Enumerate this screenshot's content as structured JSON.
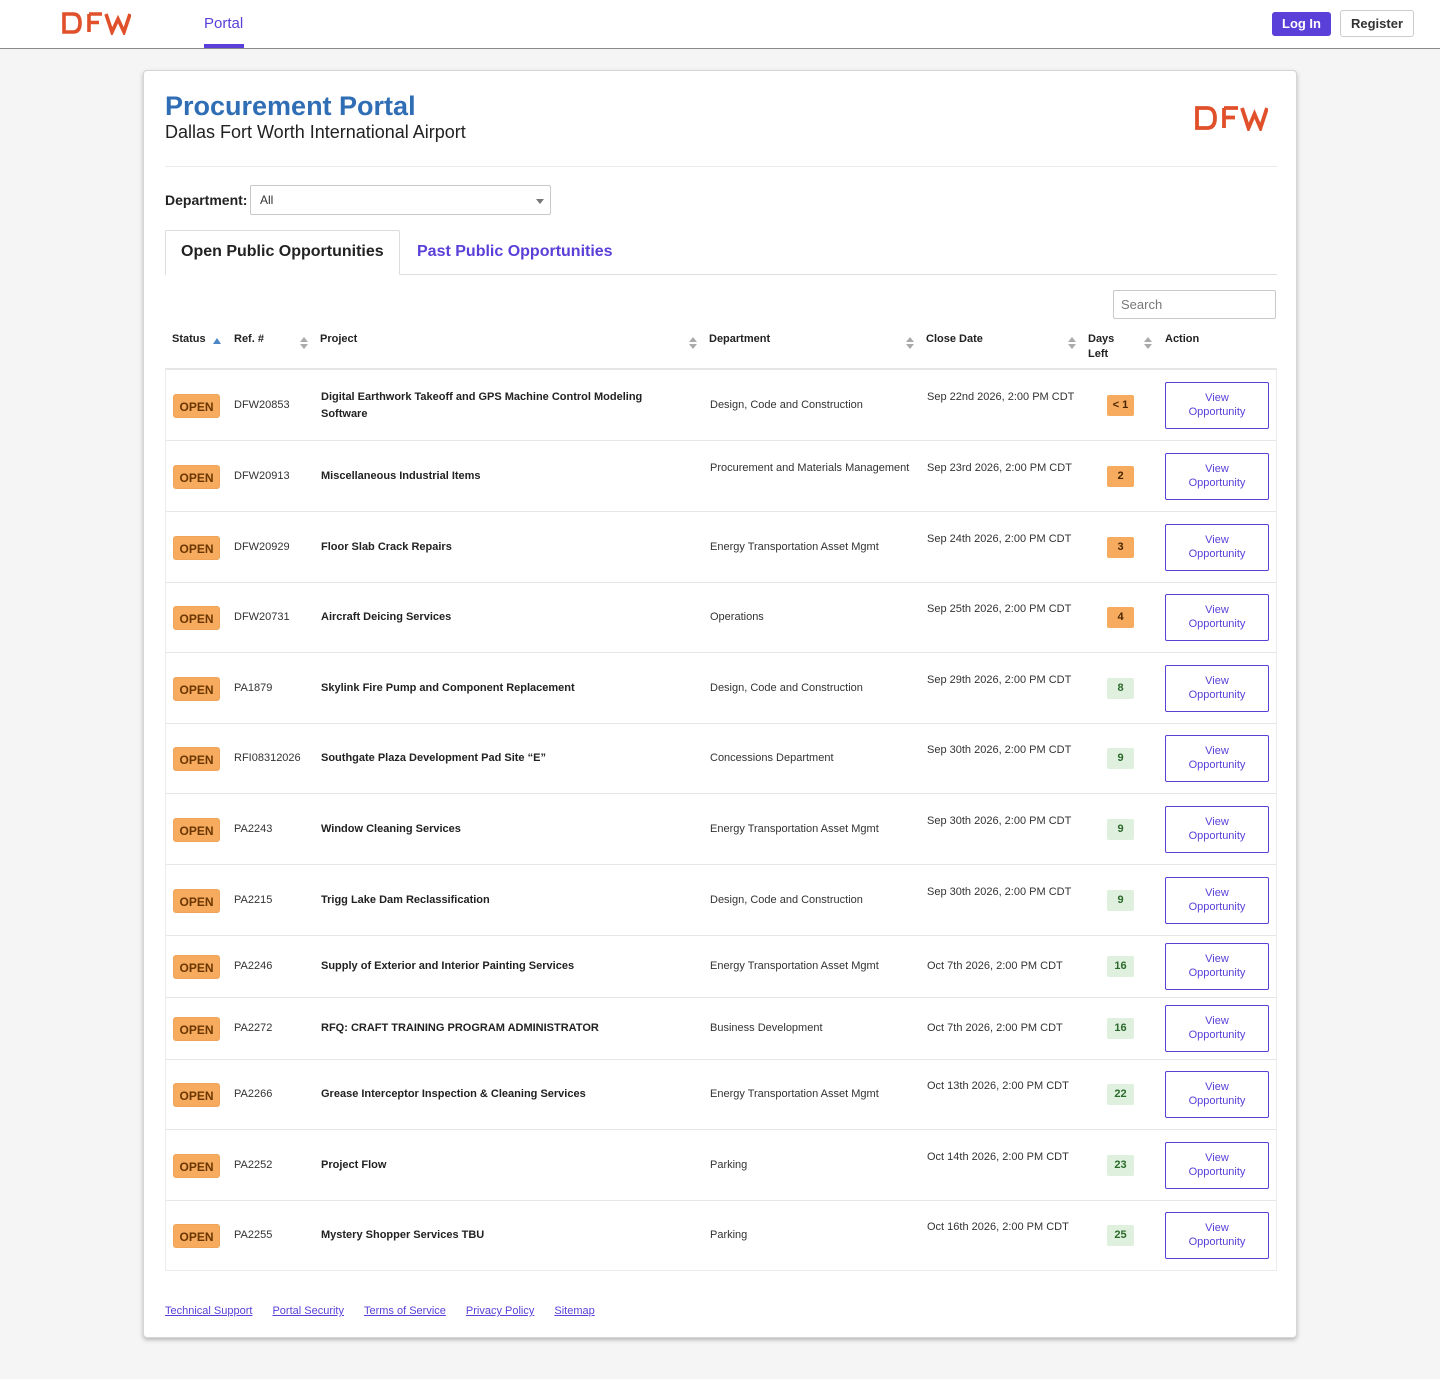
{
  "nav": {
    "logo_text": "DFW",
    "tab_label": "Portal",
    "login_label": "Log In",
    "register_label": "Register"
  },
  "header": {
    "title": "Procurement Portal",
    "subtitle": "Dallas Fort Worth International Airport",
    "logo_text": "DFW"
  },
  "filter": {
    "department_label": "Department:",
    "department_value": "All"
  },
  "tabs": [
    {
      "label": "Open Public Opportunities",
      "active": true
    },
    {
      "label": "Past Public Opportunities",
      "active": false
    }
  ],
  "search": {
    "placeholder": "Search"
  },
  "table": {
    "columns": {
      "status": "Status",
      "ref": "Ref. #",
      "project": "Project",
      "department": "Department",
      "close_date": "Close Date",
      "days_left": "Days Left",
      "action": "Action"
    },
    "rows": [
      {
        "status": "OPEN",
        "ref": "DFW20853",
        "project": "Digital Earthwork Takeoff and GPS Machine Control Modeling Software",
        "department": "Design, Code and Construction",
        "close_date": "Sep 22nd 2026, 2:00 PM CDT",
        "days_left": "< 1",
        "days_color": "orange",
        "action": "View Opportunity"
      },
      {
        "status": "OPEN",
        "ref": "DFW20913",
        "project": "Miscellaneous Industrial Items",
        "department": "Procurement and Materials Management",
        "close_date": "Sep 23rd 2026, 2:00 PM CDT",
        "days_left": "2",
        "days_color": "orange",
        "action": "View Opportunity"
      },
      {
        "status": "OPEN",
        "ref": "DFW20929",
        "project": "Floor Slab Crack Repairs",
        "department": "Energy Transportation Asset Mgmt",
        "close_date": "Sep 24th 2026, 2:00 PM CDT",
        "days_left": "3",
        "days_color": "orange",
        "action": "View Opportunity"
      },
      {
        "status": "OPEN",
        "ref": "DFW20731",
        "project": "Aircraft Deicing Services",
        "department": "Operations",
        "close_date": "Sep 25th 2026, 2:00 PM CDT",
        "days_left": "4",
        "days_color": "orange",
        "action": "View Opportunity"
      },
      {
        "status": "OPEN",
        "ref": "PA1879",
        "project": "Skylink Fire Pump and Component Replacement",
        "department": "Design, Code and Construction",
        "close_date": "Sep 29th 2026, 2:00 PM CDT",
        "days_left": "8",
        "days_color": "green",
        "action": "View Opportunity"
      },
      {
        "status": "OPEN",
        "ref": "RFI08312026",
        "project": "Southgate Plaza Development Pad Site “E”",
        "department": "Concessions Department",
        "close_date": "Sep 30th 2026, 2:00 PM CDT",
        "days_left": "9",
        "days_color": "green",
        "action": "View Opportunity"
      },
      {
        "status": "OPEN",
        "ref": "PA2243",
        "project": "Window Cleaning Services",
        "department": "Energy Transportation Asset Mgmt",
        "close_date": "Sep 30th 2026, 2:00 PM CDT",
        "days_left": "9",
        "days_color": "green",
        "action": "View Opportunity"
      },
      {
        "status": "OPEN",
        "ref": "PA2215",
        "project": "Trigg Lake Dam Reclassification",
        "department": "Design, Code and Construction",
        "close_date": "Sep 30th 2026, 2:00 PM CDT",
        "days_left": "9",
        "days_color": "green",
        "action": "View Opportunity"
      },
      {
        "status": "OPEN",
        "ref": "PA2246",
        "project": "Supply of Exterior and Interior Painting Services",
        "department": "Energy Transportation Asset Mgmt",
        "close_date": "Oct 7th 2026, 2:00 PM CDT",
        "days_left": "16",
        "days_color": "green",
        "action": "View Opportunity"
      },
      {
        "status": "OPEN",
        "ref": "PA2272",
        "project": "RFQ: CRAFT TRAINING PROGRAM ADMINISTRATOR",
        "department": "Business Development",
        "close_date": "Oct 7th 2026, 2:00 PM CDT",
        "days_left": "16",
        "days_color": "green",
        "action": "View Opportunity"
      },
      {
        "status": "OPEN",
        "ref": "PA2266",
        "project": "Grease Interceptor Inspection & Cleaning Services",
        "department": "Energy Transportation Asset Mgmt",
        "close_date": "Oct 13th 2026, 2:00 PM CDT",
        "days_left": "22",
        "days_color": "green",
        "action": "View Opportunity"
      },
      {
        "status": "OPEN",
        "ref": "PA2252",
        "project": "Project Flow",
        "department": "Parking",
        "close_date": "Oct 14th 2026, 2:00 PM CDT",
        "days_left": "23",
        "days_color": "green",
        "action": "View Opportunity"
      },
      {
        "status": "OPEN",
        "ref": "PA2255",
        "project": "Mystery Shopper Services TBU",
        "department": "Parking",
        "close_date": "Oct 16th 2026, 2:00 PM CDT",
        "days_left": "25",
        "days_color": "green",
        "action": "View Opportunity"
      }
    ]
  },
  "footer": {
    "links": [
      "Technical Support",
      "Portal Security",
      "Terms of Service",
      "Privacy Policy",
      "Sitemap"
    ]
  },
  "colors": {
    "accent": "#5a3fd9",
    "title_blue": "#2f6db5",
    "logo_orange": "#e0502a",
    "badge_orange": "#f6ab5e",
    "days_green_bg": "#dff1de"
  }
}
